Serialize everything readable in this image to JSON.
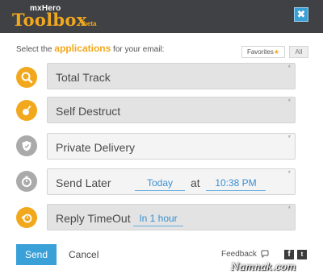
{
  "header": {
    "brand_small": "mxHero",
    "brand_big": "Toolbox",
    "brand_beta": "beta",
    "close_glyph": "✖"
  },
  "prompt": {
    "before": "Select the ",
    "accent": "applications",
    "after": " for your email:"
  },
  "filters": {
    "favorites_label": "Favorites",
    "favorites_star": "★",
    "all_label": "All"
  },
  "apps": [
    {
      "label": "Total Track",
      "icon": "magnifier-icon",
      "active": true,
      "favorite_mark": "*"
    },
    {
      "label": "Self Destruct",
      "icon": "bomb-icon",
      "active": true,
      "favorite_mark": "*"
    },
    {
      "label": "Private Delivery",
      "icon": "shield-icon",
      "active": false,
      "favorite_mark": "*"
    },
    {
      "label": "Send Later",
      "icon": "timer-icon",
      "active": false,
      "favorite_mark": "*",
      "date_value": "Today",
      "at_label": "at",
      "time_value": "10:38 PM"
    },
    {
      "label": "Reply TimeOut",
      "icon": "reply-clock-icon",
      "active": true,
      "favorite_mark": "*",
      "duration_value": "In 1 hour"
    }
  ],
  "footer": {
    "send_label": "Send",
    "cancel_label": "Cancel",
    "feedback_label": "Feedback",
    "feedback_icon": "speech-bubble-icon",
    "facebook_glyph": "f",
    "twitter_glyph": "t"
  },
  "watermark": "Namnak.com",
  "colors": {
    "header_bg": "#3f4144",
    "accent_orange": "#f2a81d",
    "accent_blue": "#3aa0d8",
    "inactive_icon": "#aaaaaa"
  }
}
